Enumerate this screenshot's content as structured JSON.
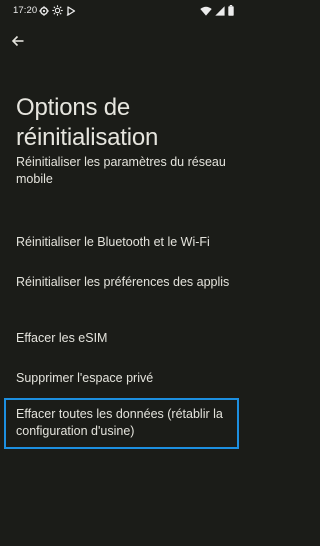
{
  "status_bar": {
    "time": "17:20",
    "left_icons": [
      "settings-gear-icon",
      "brightness-icon",
      "cast-icon"
    ],
    "right_icons": [
      "wifi-icon",
      "signal-icon",
      "battery-icon"
    ]
  },
  "header": {
    "back_icon": "arrow-back-icon"
  },
  "page": {
    "title": "Options de réinitialisation"
  },
  "options": [
    {
      "label": "Réinitialiser les paramètres du réseau mobile"
    },
    {
      "label": "Réinitialiser le Bluetooth et le Wi-Fi"
    },
    {
      "label": "Réinitialiser les préférences des applis"
    },
    {
      "label": "Effacer les eSIM"
    },
    {
      "label": "Supprimer l'espace privé"
    },
    {
      "label": "Effacer toutes les données (rétablir la configuration d'usine)"
    }
  ],
  "colors": {
    "background": "#1b1c18",
    "text": "#e4e3dc",
    "focus": "#1d8fe0"
  }
}
